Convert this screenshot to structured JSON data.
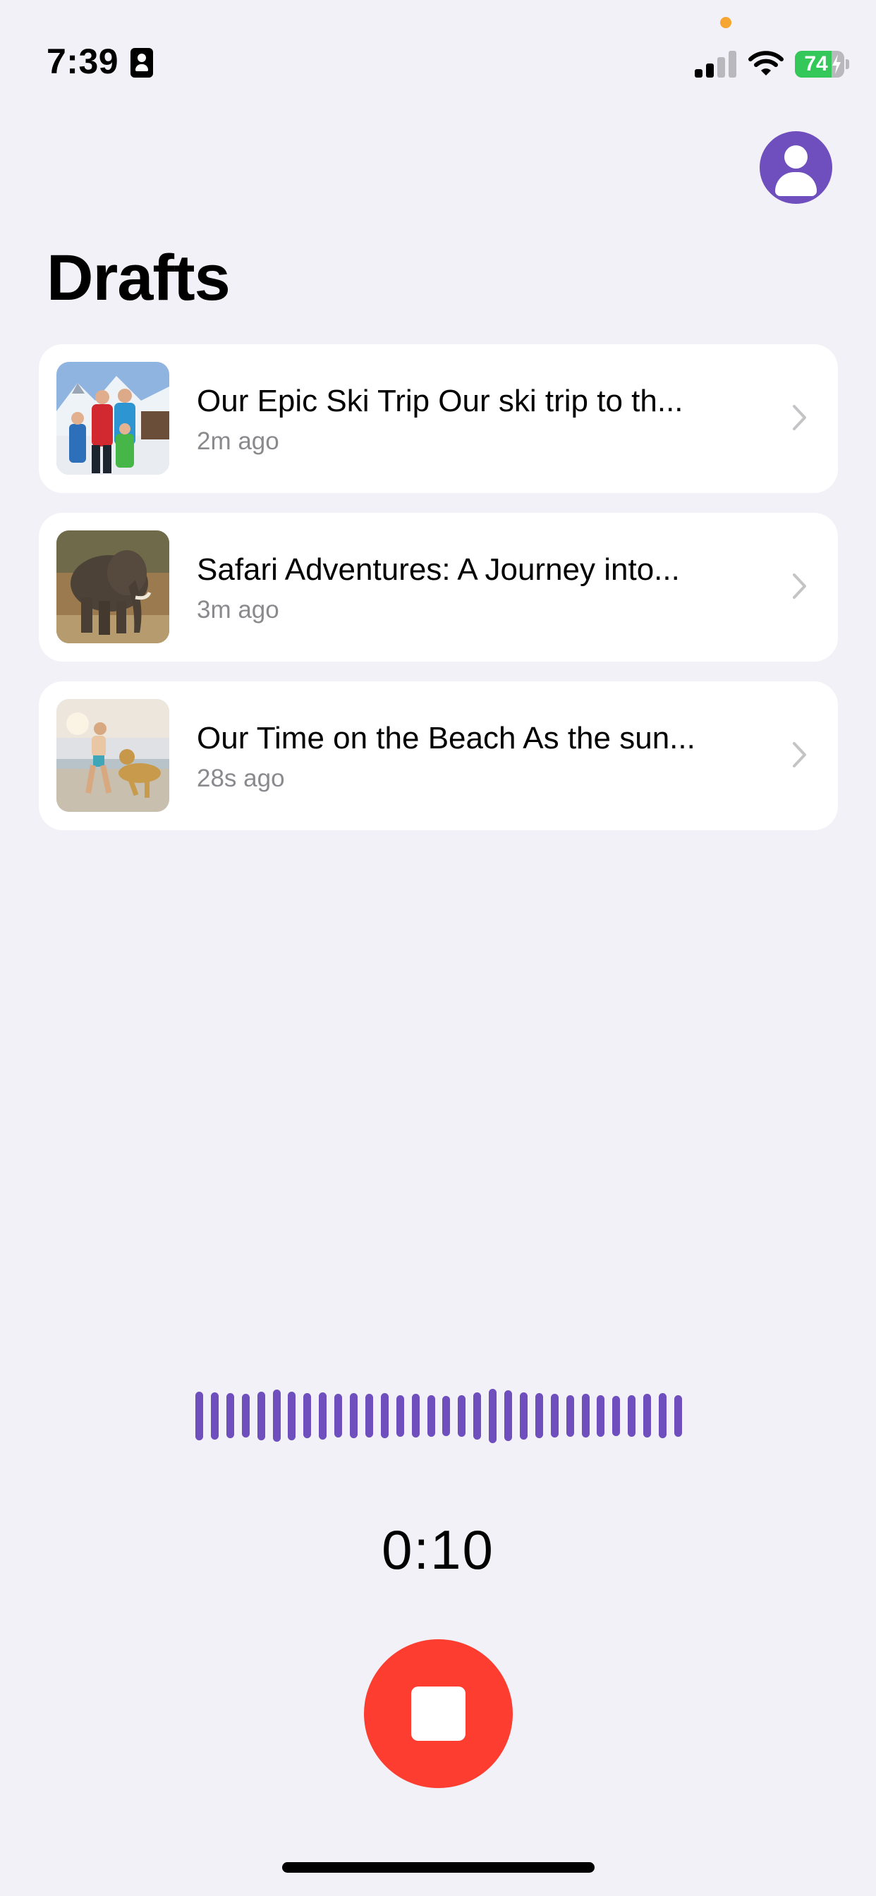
{
  "status_bar": {
    "time": "7:39",
    "battery_level": "74",
    "battery_charging": true,
    "signal_bars_active": 2,
    "signal_bars_total": 4
  },
  "header": {
    "title": "Drafts",
    "profile_icon": "person-circle-icon"
  },
  "drafts": [
    {
      "title": "Our Epic Ski Trip Our ski trip to th...",
      "time": "2m ago",
      "thumbnail": "ski-family-photo"
    },
    {
      "title": "Safari Adventures: A Journey into...",
      "time": "3m ago",
      "thumbnail": "elephant-photo"
    },
    {
      "title": "Our Time on the Beach As the sun...",
      "time": "28s ago",
      "thumbnail": "beach-dog-photo"
    }
  ],
  "recorder": {
    "elapsed": "0:10",
    "waveform_levels": [
      0.48,
      0.46,
      0.44,
      0.42,
      0.48,
      0.52,
      0.48,
      0.44,
      0.46,
      0.42,
      0.44,
      0.42,
      0.44,
      0.4,
      0.42,
      0.4,
      0.38,
      0.4,
      0.46,
      0.54,
      0.5,
      0.46,
      0.44,
      0.42,
      0.4,
      0.42,
      0.4,
      0.38,
      0.4,
      0.42,
      0.44,
      0.4
    ],
    "stop_icon": "stop-icon"
  },
  "colors": {
    "accent": "#6f4fbd",
    "record_red": "#fc3d30",
    "background": "#f2f1f7",
    "secondary_text": "#8a8a8e",
    "battery_green": "#34c759"
  }
}
